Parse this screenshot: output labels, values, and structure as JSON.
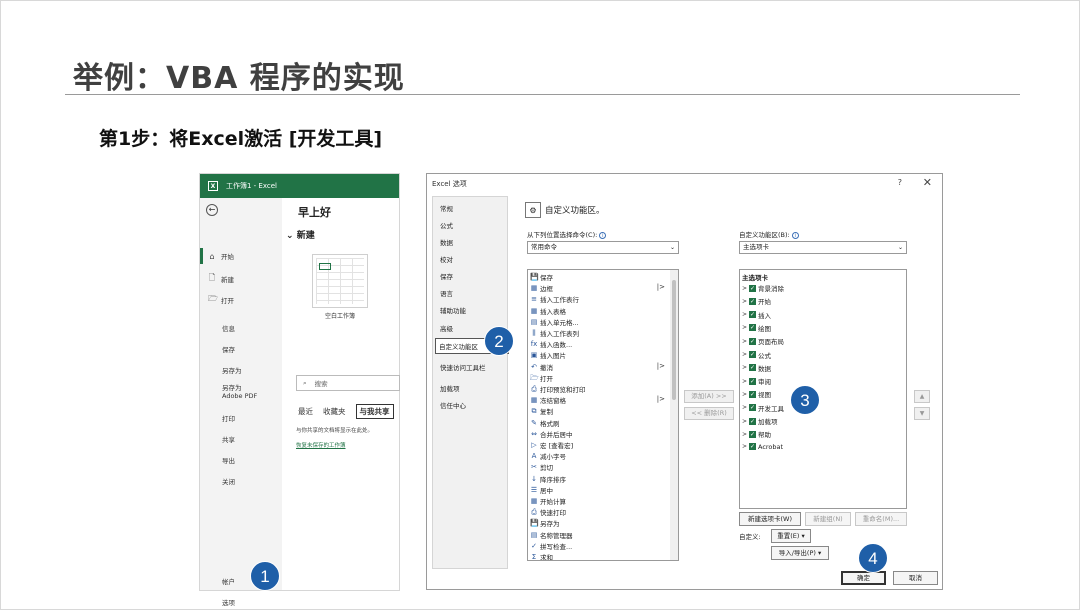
{
  "slide": {
    "title": "举例：VBA 程序的实现",
    "subtitle": "第1步：将Excel激活 [开发工具]"
  },
  "backstage": {
    "window_title": "工作簿1 - Excel",
    "app_icon": "X",
    "back": "←",
    "nav": [
      {
        "label": "开始",
        "icon": "⌂"
      },
      {
        "label": "新建",
        "icon": "🗋"
      },
      {
        "label": "打开",
        "icon": "🗁"
      }
    ],
    "nav_plain": [
      "信息",
      "保存",
      "另存为",
      "另存为\nAdobe PDF",
      "打印",
      "共享",
      "导出",
      "关闭"
    ],
    "nav_bottom": [
      "帐户",
      "选项"
    ],
    "greeting": "早上好",
    "new_heading": "新建",
    "blank_workbook": "空白工作簿",
    "search_placeholder": "搜索",
    "tabs": [
      "最近",
      "收藏夹",
      "与我共享"
    ],
    "note": "与你共享的文档将显示在此处。",
    "link": "恢复未保存的工作簿"
  },
  "dialog": {
    "title": "Excel 选项",
    "help": "?",
    "close": "✕",
    "categories": [
      "常规",
      "公式",
      "数据",
      "校对",
      "保存",
      "语言",
      "辅助功能",
      "高级",
      "自定义功能区",
      "快速访问工具栏",
      "加载项",
      "信任中心"
    ],
    "header": "自定义功能区。",
    "choose_label": "从下列位置选择命令(C):",
    "choose_value": "常用命令",
    "customize_label": "自定义功能区(B):",
    "customize_value": "主选项卡",
    "commands": [
      {
        "label": "保存",
        "icon": "💾"
      },
      {
        "label": "边框",
        "icon": "▦",
        "sub": true
      },
      {
        "label": "插入工作表行",
        "icon": "≡"
      },
      {
        "label": "插入表格",
        "icon": "▦"
      },
      {
        "label": "插入单元格...",
        "icon": "▤"
      },
      {
        "label": "插入工作表列",
        "icon": "⫼"
      },
      {
        "label": "插入函数...",
        "icon": "fx"
      },
      {
        "label": "插入图片",
        "icon": "▣"
      },
      {
        "label": "撤消",
        "icon": "↶",
        "sub": true
      },
      {
        "label": "打开",
        "icon": "🗁"
      },
      {
        "label": "打印预览和打印",
        "icon": "⎙"
      },
      {
        "label": "冻结窗格",
        "icon": "▦",
        "sub": true
      },
      {
        "label": "复制",
        "icon": "⧉"
      },
      {
        "label": "格式刷",
        "icon": "✎"
      },
      {
        "label": "合并后居中",
        "icon": "⇔"
      },
      {
        "label": "宏 [查看宏]",
        "icon": "▷"
      },
      {
        "label": "减小字号",
        "icon": "A"
      },
      {
        "label": "剪切",
        "icon": "✂"
      },
      {
        "label": "降序排序",
        "icon": "↓"
      },
      {
        "label": "居中",
        "icon": "☰"
      },
      {
        "label": "开始计算",
        "icon": "▦"
      },
      {
        "label": "快速打印",
        "icon": "⎙"
      },
      {
        "label": "另存为",
        "icon": "💾"
      },
      {
        "label": "名称管理器",
        "icon": "▤"
      },
      {
        "label": "拼写检查...",
        "icon": "✓"
      },
      {
        "label": "求和",
        "icon": "Σ"
      }
    ],
    "tree_title": "主选项卡",
    "tabs_tree": [
      "背景消除",
      "开始",
      "插入",
      "绘图",
      "页面布局",
      "公式",
      "数据",
      "审阅",
      "视图",
      "开发工具",
      "加载项",
      "帮助",
      "Acrobat"
    ],
    "add_button": "添加(A) >>",
    "remove_button": "<< 删除(R)",
    "up": "▲",
    "down": "▼",
    "new_tab": "新建选项卡(W)",
    "new_group": "新建组(N)",
    "rename": "重命名(M)...",
    "customize_short": "自定义:",
    "reset": "重置(E) ▾",
    "import_export": "导入/导出(P) ▾",
    "ok": "确定",
    "cancel": "取消"
  },
  "badges": [
    "1",
    "2",
    "3",
    "4"
  ],
  "colors": {
    "excel_green": "#217346",
    "badge_blue": "#1f5fa8"
  }
}
